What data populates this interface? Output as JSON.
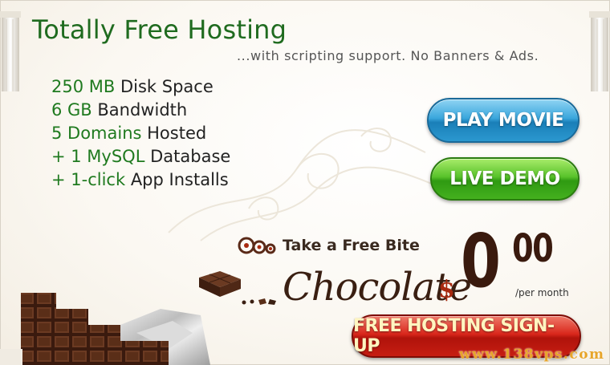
{
  "header": {
    "title": "Totally Free Hosting",
    "subtitle": "...with scripting support. No Banners & Ads."
  },
  "features": [
    {
      "highlight": "250 MB",
      "text": " Disk Space"
    },
    {
      "highlight": "6 GB",
      "text": " Bandwidth"
    },
    {
      "highlight": "5 Domains",
      "text": " Hosted"
    },
    {
      "highlight": "+ 1 MySQL",
      "text": " Database"
    },
    {
      "highlight": "+ 1-click",
      "text": " App Installs"
    }
  ],
  "buttons": {
    "play_movie": "PLAY MOVIE",
    "live_demo": "LIVE DEMO",
    "signup": "FREE HOSTING SIGN-UP"
  },
  "promo": {
    "tagline": "Take a Free Bite",
    "product": "Chocolate"
  },
  "price": {
    "currency": "$",
    "whole": "0",
    "cents": "00",
    "period": "/per month"
  },
  "watermark": "www.138vps.com",
  "colors": {
    "title_green": "#1f6b1f",
    "play_movie_blue": "#2b98cf",
    "live_demo_green": "#44b01e",
    "signup_red": "#c61d12",
    "chocolate_brown": "#3a1f12"
  },
  "icons": [
    "pillar-icon",
    "swirl-ornament",
    "bite-mark-icon",
    "chocolate-piece-icon",
    "chocolate-bar-image"
  ]
}
